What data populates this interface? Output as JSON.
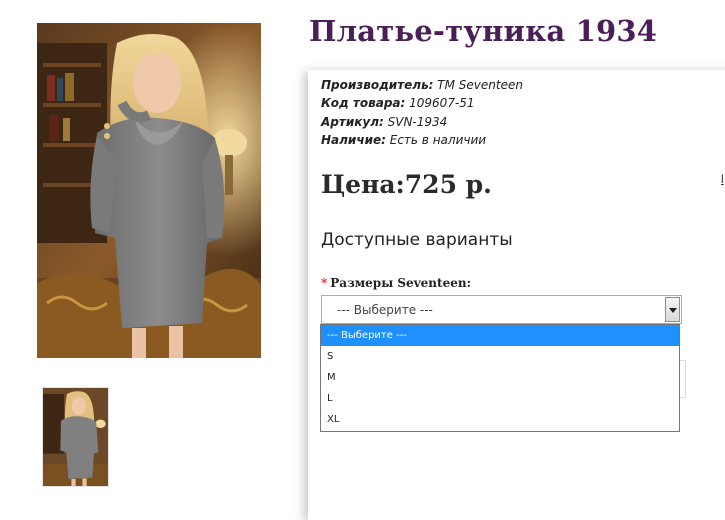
{
  "product": {
    "title": "Платье-туника 1934",
    "manufacturer_label": "Производитель:",
    "manufacturer_value": "TM Seventeen",
    "code_label": "Код товара:",
    "code_value": "109607-51",
    "article_label": "Артикул:",
    "article_value": "SVN-1934",
    "stock_label": "Наличие:",
    "stock_value": "Есть в наличии",
    "price": "Цена:725 р."
  },
  "options": {
    "heading": "Доступные варианты",
    "required_mark": "*",
    "size_label": "Размеры Seventeen:",
    "select_value": "--- Выберите ---",
    "dropdown": [
      "--- Выберите ---",
      "S",
      "M",
      "L",
      "XL"
    ]
  },
  "colors": {
    "title": "#4a1f57",
    "highlight": "#1e90ff",
    "required": "#e0282c"
  }
}
